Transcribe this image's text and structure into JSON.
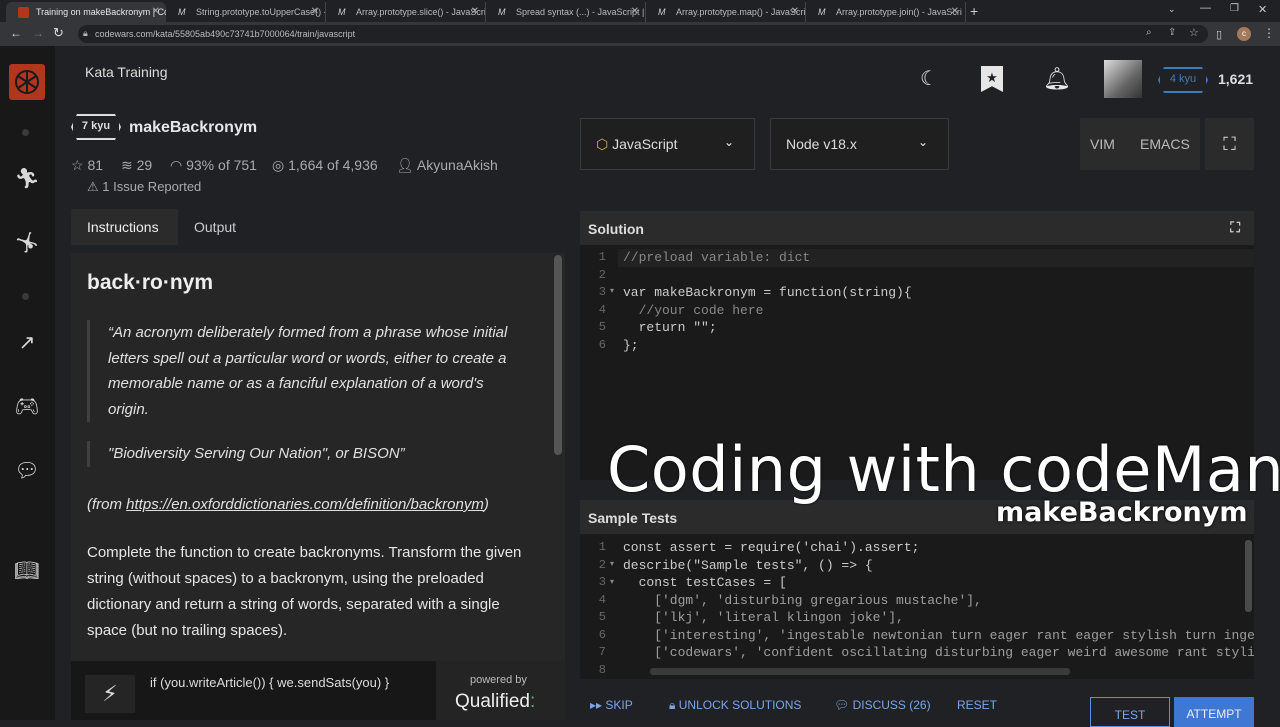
{
  "browser": {
    "tabs": [
      {
        "title": "Training on makeBackronym | Co",
        "fav": "cw"
      },
      {
        "title": "String.prototype.toUpperCase() -",
        "fav": "M"
      },
      {
        "title": "Array.prototype.slice() - JavaScri",
        "fav": "M"
      },
      {
        "title": "Spread syntax (...) - JavaScript | M",
        "fav": "M"
      },
      {
        "title": "Array.prototype.map() - JavaScri",
        "fav": "M"
      },
      {
        "title": "Array.prototype.join() - JavaScri",
        "fav": "M"
      }
    ],
    "url": "codewars.com/kata/55805ab490c73741b7000064/train/javascript",
    "profile_initial": "c"
  },
  "header": {
    "title": "Kata Training",
    "rank": "4 kyu",
    "honor": "1,621"
  },
  "kata": {
    "rank": "7 kyu",
    "name": "makeBackronym",
    "stars": "81",
    "collections": "29",
    "satisfaction": "93%",
    "satisfaction_of": "of 751",
    "completed": "1,664",
    "completed_of": "of 4,936",
    "author": "AkyunaAkish",
    "issues": "1 Issue Reported"
  },
  "tabs": {
    "instructions": "Instructions",
    "output": "Output"
  },
  "description": {
    "heading": "back·ro·nym",
    "quote1": "“An acronym deliberately formed from a phrase whose initial letters spell out a particular word or words, either to create a memorable name or as a fanciful explanation of a word's origin.",
    "quote2": "\"Biodiversity Serving Our Nation\", or BISON”",
    "from_prefix": "(from ",
    "from_link": "https://en.oxforddictionaries.com/definition/backronym",
    "from_suffix": ")",
    "body": "Complete the function to create backronyms. Transform the given string (without spaces) to a backronym, using the preloaded dictionary and return a string of words, separated with a single space (but no trailing spaces)."
  },
  "qualified": {
    "tagline": "if (you.writeArticle()) { we.sendSats(you) }",
    "powered": "powered by",
    "brand": "Qualified"
  },
  "editor": {
    "language": "JavaScript",
    "runtime": "Node v18.x",
    "vim": "VIM",
    "emacs": "EMACS",
    "solution_title": "Solution",
    "tests_title": "Sample Tests",
    "solution_lines": [
      "//preload variable: dict",
      "",
      "var makeBackronym = function(string){",
      "  //your code here",
      "  return \"\";",
      "};"
    ],
    "test_lines": [
      "const assert = require('chai').assert;",
      "describe(\"Sample tests\", () => {",
      "  const testCases = [",
      "    ['dgm', 'disturbing gregarious mustache'],",
      "    ['lkj', 'literal klingon joke'],",
      "    ['interesting', 'ingestable newtonian turn eager rant eager stylish turn inges",
      "    ['codewars', 'confident oscillating disturbing eager weird awesome rant stylis"
    ]
  },
  "actions": {
    "skip": "SKIP",
    "unlock": "UNLOCK SOLUTIONS",
    "discuss": "DISCUSS (26)",
    "reset": "RESET",
    "test": "TEST",
    "attempt": "ATTEMPT"
  },
  "overlay": {
    "title": "Coding with codeManS",
    "subtitle": "makeBackronym"
  },
  "colors": {
    "accent": "#b1361e",
    "link_blue": "#7aa6e8",
    "rank_blue": "#3c7ebb"
  }
}
